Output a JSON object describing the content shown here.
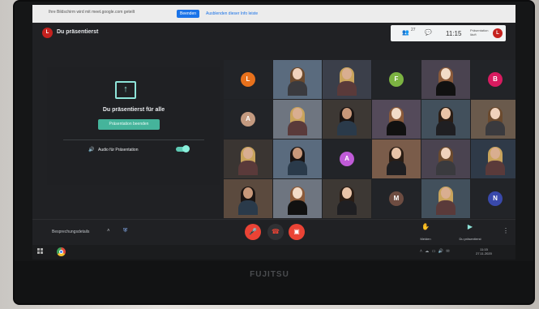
{
  "infobar": {
    "message": "Ihre Bildschirm wird mit meet.google.com geteilt",
    "stop_label": "Beenden",
    "hide_label": "Ausblenden dieser Info leiste"
  },
  "header": {
    "user_initial": "L",
    "title": "Du präsentierst",
    "participant_count": "27",
    "time": "11:15",
    "presenting_note": "Präsentation läuft",
    "self_initial": "L"
  },
  "presentation_panel": {
    "icon": "present-screen-icon",
    "title": "Du präsentierst für alle",
    "end_button": "Präsentation beenden",
    "audio_label": "Audio für Präsentation",
    "audio_on": true
  },
  "participants": [
    {
      "type": "initial",
      "letter": "L",
      "color": "#e8711c"
    },
    {
      "type": "video"
    },
    {
      "type": "video"
    },
    {
      "type": "initial",
      "letter": "F",
      "color": "#7cb342"
    },
    {
      "type": "video"
    },
    {
      "type": "initial",
      "letter": "B",
      "color": "#d81b60"
    },
    {
      "type": "initial",
      "letter": "A",
      "color": "#c49a80"
    },
    {
      "type": "video"
    },
    {
      "type": "video"
    },
    {
      "type": "video"
    },
    {
      "type": "video"
    },
    {
      "type": "video"
    },
    {
      "type": "video"
    },
    {
      "type": "video"
    },
    {
      "type": "initial",
      "letter": "A",
      "color": "#c05bd8"
    },
    {
      "type": "video"
    },
    {
      "type": "video"
    },
    {
      "type": "video"
    },
    {
      "type": "video"
    },
    {
      "type": "video"
    },
    {
      "type": "video"
    },
    {
      "type": "initial",
      "letter": "M",
      "color": "#6d4c41"
    },
    {
      "type": "video"
    },
    {
      "type": "initial",
      "letter": "N",
      "color": "#3949ab"
    }
  ],
  "bottombar": {
    "details_label": "Besprechungsdetails",
    "raise_label": "Melden",
    "present_label": "Du präsentierst"
  },
  "taskbar": {
    "time": "11:15",
    "date": "27.11.2020"
  },
  "laptop_brand": "FUJITSU",
  "colors": {
    "accent": "#45b49b",
    "danger": "#ea4335"
  }
}
